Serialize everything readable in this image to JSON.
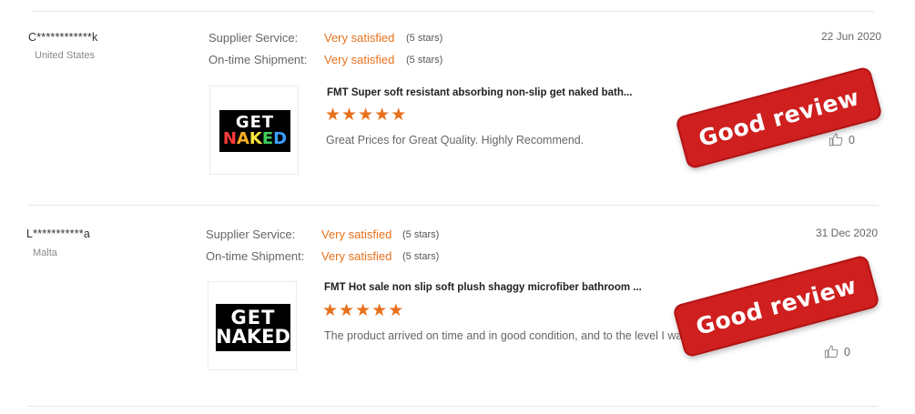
{
  "reviews": [
    {
      "user": "C************k",
      "country": "United States",
      "date": "22 Jun 2020",
      "supplier_service_label": "Supplier Service:",
      "supplier_service_value": "Very satisfied",
      "supplier_service_stars": "(5 stars)",
      "shipment_label": "On-time Shipment:",
      "shipment_value": "Very satisfied",
      "shipment_stars": "(5 stars)",
      "product_title": "FMT Super soft resistant absorbing non-slip get naked bath...",
      "product_image_line1": "GET",
      "product_image_line2": "NAKED",
      "rating": 5,
      "comment": "Great Prices for Great Quality. Highly Recommend.",
      "likes": "0",
      "stamp": "Good review"
    },
    {
      "user": "L***********a",
      "country": "Malta",
      "date": "31 Dec 2020",
      "supplier_service_label": "Supplier Service:",
      "supplier_service_value": "Very satisfied",
      "supplier_service_stars": "(5 stars)",
      "shipment_label": "On-time Shipment:",
      "shipment_value": "Very satisfied",
      "shipment_stars": "(5 stars)",
      "product_title": "FMT Hot sale non slip soft plush shaggy microfiber bathroom ...",
      "product_image_line1": "GET",
      "product_image_line2": "NAKED",
      "rating": 5,
      "comment": "The product arrived on time and in good condition, and to the level I was expecting.",
      "likes": "0",
      "stamp": "Good review"
    }
  ],
  "icons": {
    "like": "thumbs-up-icon",
    "star": "star-icon"
  },
  "colors": {
    "accent": "#e8711c",
    "stamp": "#cf1f1f"
  }
}
